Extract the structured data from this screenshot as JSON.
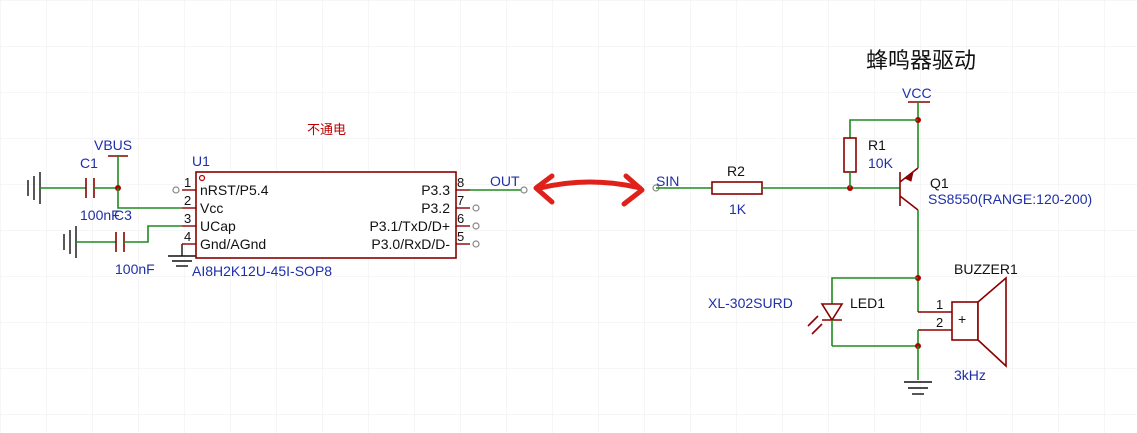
{
  "title": "蜂鸣器驱动",
  "note": "不通电",
  "colors": {
    "wire": "#1e8a1e",
    "part": "#8b0000",
    "label": "#1f2fa8",
    "annotation": "#e0201a",
    "grid": "#e8e8e8"
  },
  "power": {
    "vbus": "VBUS",
    "vcc": "VCC"
  },
  "nets": {
    "out": "OUT",
    "sin": "SIN"
  },
  "c1": {
    "ref": "C1",
    "value": "100nF"
  },
  "c3": {
    "ref": "C3",
    "value": "100nF"
  },
  "u1": {
    "ref": "U1",
    "part": "AI8H2K12U-45I-SOP8",
    "pins": [
      {
        "num": "1",
        "name": "nRST/P5.4"
      },
      {
        "num": "2",
        "name": "Vcc"
      },
      {
        "num": "3",
        "name": "UCap"
      },
      {
        "num": "4",
        "name": "Gnd/AGnd"
      },
      {
        "num": "8",
        "name": "P3.3"
      },
      {
        "num": "7",
        "name": "P3.2"
      },
      {
        "num": "6",
        "name": "P3.1/TxD/D+"
      },
      {
        "num": "5",
        "name": "P3.0/RxD/D-"
      }
    ]
  },
  "r1": {
    "ref": "R1",
    "value": "10K"
  },
  "r2": {
    "ref": "R2",
    "value": "1K"
  },
  "q1": {
    "ref": "Q1",
    "value": "SS8550(RANGE:120-200)"
  },
  "led1": {
    "ref": "LED1",
    "value": "XL-302SURD"
  },
  "buzzer1": {
    "ref": "BUZZER1",
    "value": "3kHz",
    "pin1": "1",
    "pin2": "2",
    "plus": "+"
  }
}
